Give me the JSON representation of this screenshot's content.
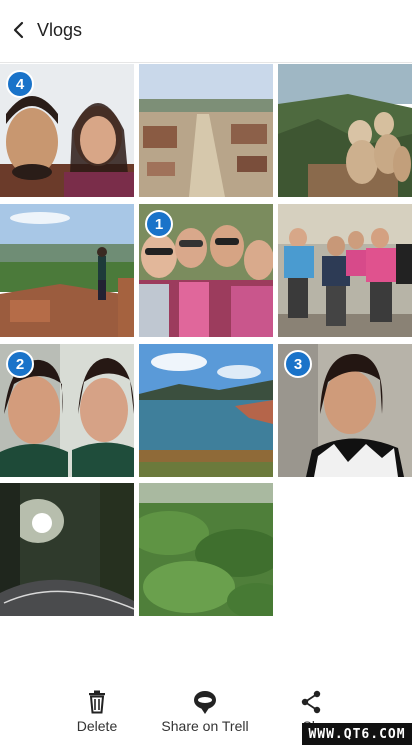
{
  "header": {
    "back_icon": "chevron-left-icon",
    "title": "Vlogs"
  },
  "photos": [
    {
      "scene": "two people selfie",
      "selection_number": "4"
    },
    {
      "scene": "ancient ruins pathway",
      "selection_number": ""
    },
    {
      "scene": "monkeys on hill",
      "selection_number": ""
    },
    {
      "scene": "ruins with person",
      "selection_number": ""
    },
    {
      "scene": "group selfie",
      "selection_number": "1"
    },
    {
      "scene": "hiking group",
      "selection_number": ""
    },
    {
      "scene": "two women smiling",
      "selection_number": "2"
    },
    {
      "scene": "lake landscape",
      "selection_number": ""
    },
    {
      "scene": "woman vlogging",
      "selection_number": "3"
    },
    {
      "scene": "forest road",
      "selection_number": ""
    },
    {
      "scene": "green valley",
      "selection_number": ""
    }
  ],
  "actions": {
    "delete": {
      "label": "Delete",
      "icon": "trash-icon"
    },
    "share_trell": {
      "label": "Share on Trell",
      "icon": "trell-icon"
    },
    "share": {
      "label": "Sh",
      "icon": "share-icon"
    }
  },
  "watermark": "WWW.QT6.COM",
  "colors": {
    "badge": "#1a73c9",
    "text": "#222222"
  }
}
